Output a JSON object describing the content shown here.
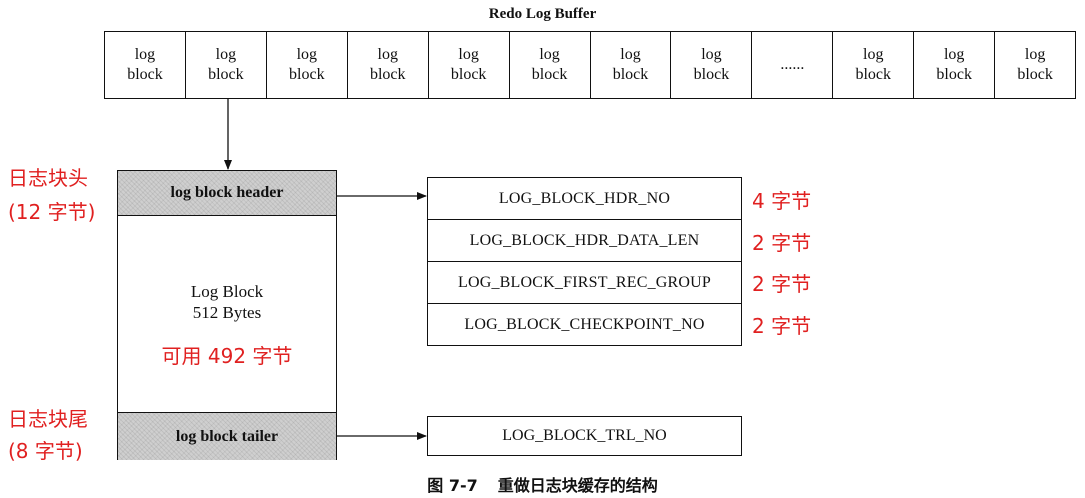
{
  "buffer": {
    "title": "Redo Log Buffer",
    "cells": [
      "log\nblock",
      "log\nblock",
      "log\nblock",
      "log\nblock",
      "log\nblock",
      "log\nblock",
      "log\nblock",
      "log\nblock",
      "......",
      "log\nblock",
      "log\nblock",
      "log\nblock"
    ]
  },
  "block": {
    "header_label": "log block header",
    "name": "Log Block",
    "size": "512 Bytes",
    "usable": "可用 492 字节",
    "tailer_label": "log block tailer"
  },
  "annotations": {
    "header_line1": "日志块头",
    "header_line2": "(12 字节)",
    "tailer_line1": "日志块尾",
    "tailer_line2": "(8 字节)"
  },
  "header_fields": [
    {
      "name": "LOG_BLOCK_HDR_NO",
      "size": "4 字节"
    },
    {
      "name": "LOG_BLOCK_HDR_DATA_LEN",
      "size": "2 字节"
    },
    {
      "name": "LOG_BLOCK_FIRST_REC_GROUP",
      "size": "2 字节"
    },
    {
      "name": "LOG_BLOCK_CHECKPOINT_NO",
      "size": "2 字节"
    }
  ],
  "tailer_field": "LOG_BLOCK_TRL_NO",
  "caption": {
    "figure": "图 7-7",
    "text": "重做日志块缓存的结构"
  },
  "colors": {
    "annotation": "#e02020",
    "hatch": "#cfcfcf"
  }
}
